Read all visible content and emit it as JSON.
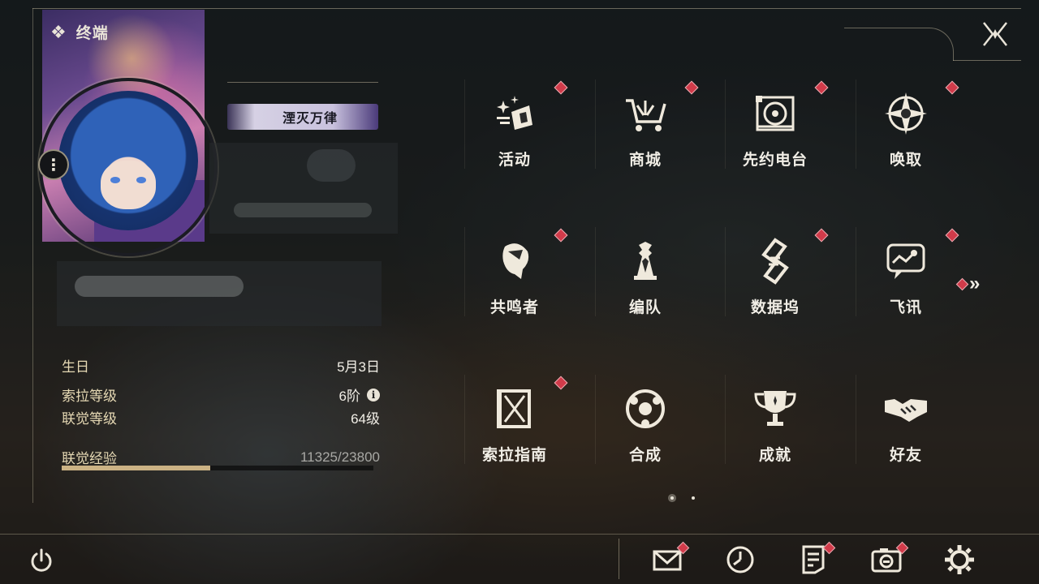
{
  "header": {
    "title": "终端",
    "icon": "diamond-cluster-icon"
  },
  "player": {
    "title_badge": "湮灭万律",
    "stats": [
      {
        "label": "生日",
        "value": "5月3日"
      },
      {
        "label": "索拉等级",
        "value": "6阶"
      },
      {
        "label": "联觉等级",
        "value": "64级"
      }
    ],
    "exp": {
      "label": "联觉经验",
      "value": "11325/23800",
      "fraction": 0.476
    }
  },
  "menu": [
    {
      "label": "活动",
      "icon": "sparkle-icon",
      "badge": true
    },
    {
      "label": "商城",
      "icon": "shopping-cart-icon",
      "badge": true
    },
    {
      "label": "先约电台",
      "icon": "radio-icon",
      "badge": true
    },
    {
      "label": "唤取",
      "icon": "compass-star-icon",
      "badge": true
    },
    {
      "label": "共鸣者",
      "icon": "character-head-icon",
      "badge": true
    },
    {
      "label": "编队",
      "icon": "chess-pieces-icon",
      "badge": false
    },
    {
      "label": "数据坞",
      "icon": "data-dock-icon",
      "badge": true
    },
    {
      "label": "飞讯",
      "icon": "message-bubble-icon",
      "badge": true
    },
    {
      "label": "索拉指南",
      "icon": "guide-book-icon",
      "badge": true
    },
    {
      "label": "合成",
      "icon": "synthesis-icon",
      "badge": false
    },
    {
      "label": "成就",
      "icon": "trophy-icon",
      "badge": false
    },
    {
      "label": "好友",
      "icon": "handshake-icon",
      "badge": false
    }
  ],
  "pager": {
    "pages": 2,
    "current": 1
  },
  "bottom_bar": [
    {
      "name": "mail",
      "icon": "mail-icon",
      "badge": true
    },
    {
      "name": "clock",
      "icon": "clock-icon",
      "badge": false
    },
    {
      "name": "notes",
      "icon": "notes-icon",
      "badge": true
    },
    {
      "name": "camera",
      "icon": "camera-icon",
      "badge": true
    },
    {
      "name": "settings",
      "icon": "gear-icon",
      "badge": false
    }
  ],
  "colors": {
    "accent": "#cbb284",
    "badge": "#d13b4a",
    "text": "#f1eee6",
    "label": "#e6d9b4"
  }
}
